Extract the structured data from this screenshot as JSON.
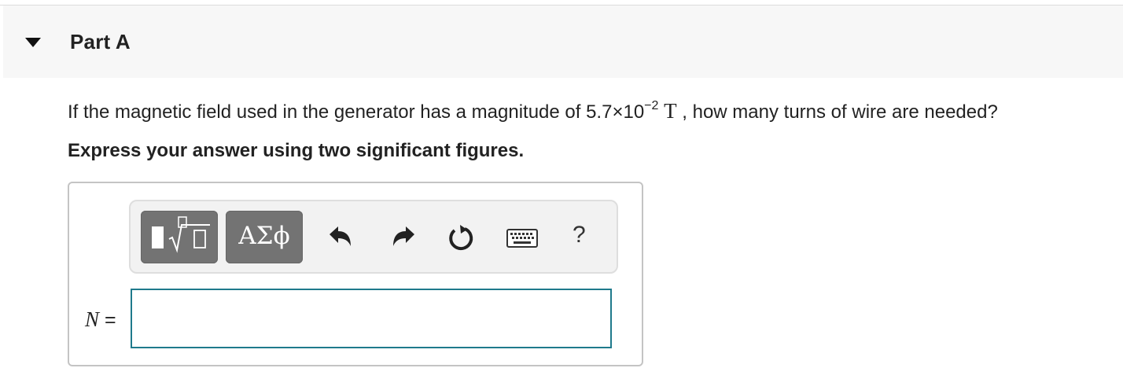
{
  "part": {
    "title": "Part A",
    "toggle_icon": "caret-down-icon"
  },
  "question": {
    "text_before": "If the magnetic field used in the generator has a magnitude of 5.7×10",
    "exponent": "−2",
    "unit": "T",
    "text_after": " , how many turns of wire are needed?"
  },
  "instruction": "Express your answer using two significant figures.",
  "toolbar": {
    "templates_icon": "templates-icon",
    "symbols_label": "ΑΣϕ",
    "undo_icon": "undo-icon",
    "redo_icon": "redo-icon",
    "reset_icon": "reset-icon",
    "keyboard_icon": "keyboard-icon",
    "help_label": "?"
  },
  "answer": {
    "variable": "N",
    "equals": " =",
    "value": "",
    "placeholder": ""
  },
  "colors": {
    "header_bg": "#f7f7f7",
    "button_bg": "#737373",
    "input_border": "#1f7a8c",
    "toolbar_bg": "#f2f2f2"
  }
}
